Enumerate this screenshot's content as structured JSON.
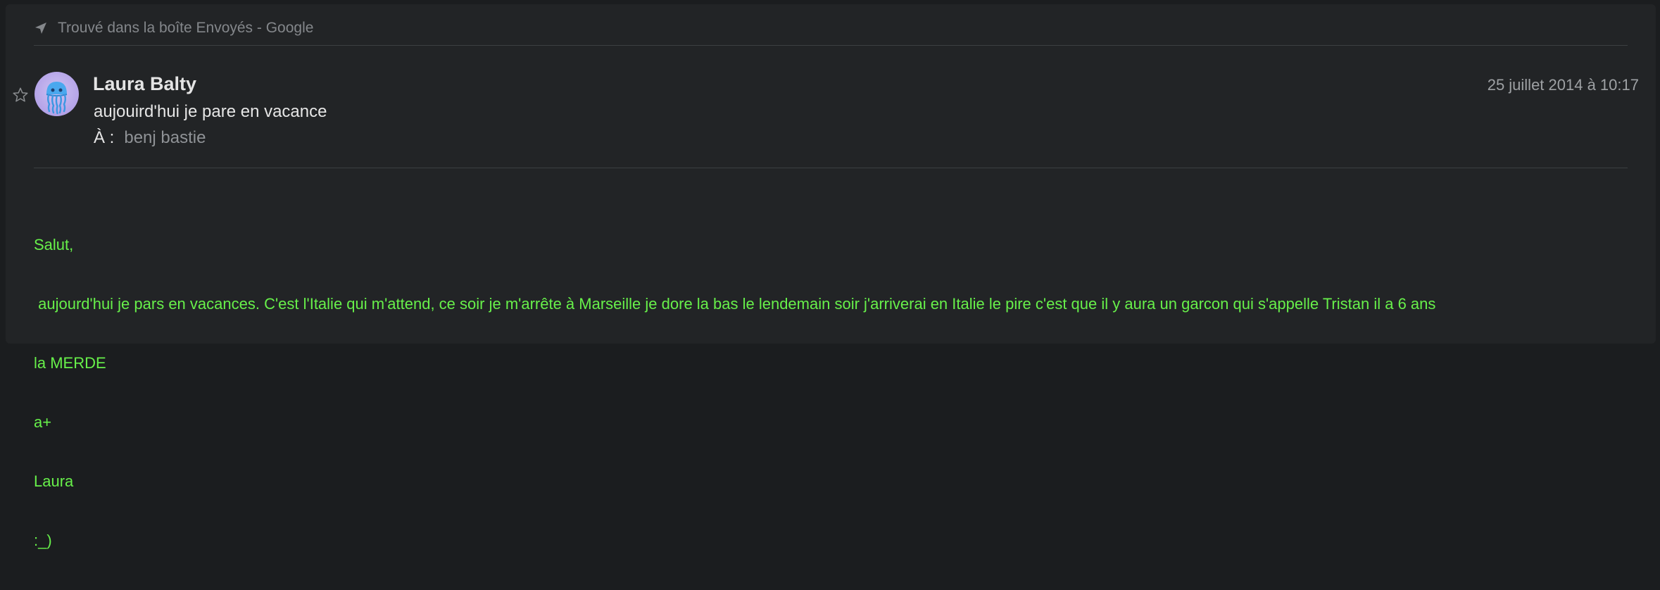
{
  "found_banner": {
    "text": "Trouvé dans la boîte Envoyés - Google",
    "icon": "send-arrow-icon"
  },
  "message": {
    "sender": "Laura Balty",
    "date": "25 juillet 2014 à 10:17",
    "subject": "aujouird'hui je pare en vacance",
    "to_label": "À :",
    "to_value": "benj bastie",
    "starred": false,
    "body_lines": [
      "Salut,",
      " aujourd'hui je pars en vacances. C'est l'Italie qui m'attend, ce soir je m'arrête à Marseille je dore la bas le lendemain soir j'arriverai en Italie le pire c'est que il y aura un garcon qui s'appelle Tristan il a 6 ans",
      "la MERDE",
      "a+",
      "Laura",
      ":_)"
    ]
  },
  "colors": {
    "background": "#222426",
    "body_text": "#67f04a",
    "avatar_bg": "#b4a3e8"
  }
}
